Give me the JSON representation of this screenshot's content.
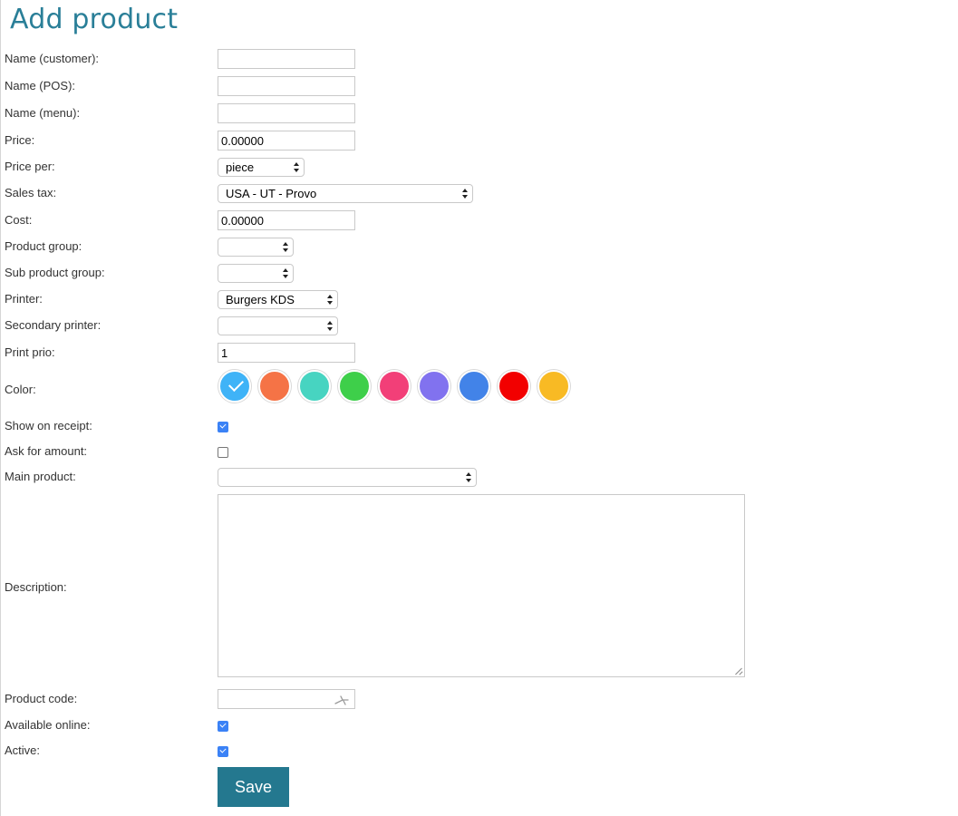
{
  "page": {
    "title": "Add product"
  },
  "fields": {
    "name_customer": {
      "label": "Name (customer):",
      "value": ""
    },
    "name_pos": {
      "label": "Name (POS):",
      "value": ""
    },
    "name_menu": {
      "label": "Name (menu):",
      "value": ""
    },
    "price": {
      "label": "Price:",
      "value": "0.00000"
    },
    "price_per": {
      "label": "Price per:",
      "selected": "piece"
    },
    "sales_tax": {
      "label": "Sales tax:",
      "selected": "USA - UT - Provo"
    },
    "cost": {
      "label": "Cost:",
      "value": "0.00000"
    },
    "product_group": {
      "label": "Product group:",
      "selected": ""
    },
    "sub_product_group": {
      "label": "Sub product group:",
      "selected": ""
    },
    "printer": {
      "label": "Printer:",
      "selected": "Burgers KDS"
    },
    "secondary_printer": {
      "label": "Secondary printer:",
      "selected": ""
    },
    "print_prio": {
      "label": "Print prio:",
      "value": "1"
    },
    "color": {
      "label": "Color:",
      "swatches": [
        "#3fb3f7",
        "#f57346",
        "#47d4c1",
        "#3ecf4a",
        "#f23f78",
        "#8172ef",
        "#4283e8",
        "#f20000",
        "#f8ba24"
      ],
      "selected_index": 0
    },
    "show_on_receipt": {
      "label": "Show on receipt:",
      "checked": true
    },
    "ask_for_amount": {
      "label": "Ask for amount:",
      "checked": false
    },
    "main_product": {
      "label": "Main product:",
      "selected": ""
    },
    "description": {
      "label": "Description:",
      "value": ""
    },
    "product_code": {
      "label": "Product code:",
      "value": "",
      "icon": "barcode-scanner-icon"
    },
    "available_online": {
      "label": "Available online:",
      "checked": true
    },
    "active": {
      "label": "Active:",
      "checked": true
    }
  },
  "actions": {
    "save_label": "Save"
  },
  "colors": {
    "accent": "#2a7f98",
    "button": "#24788f",
    "checkbox": "#3b82f6"
  }
}
